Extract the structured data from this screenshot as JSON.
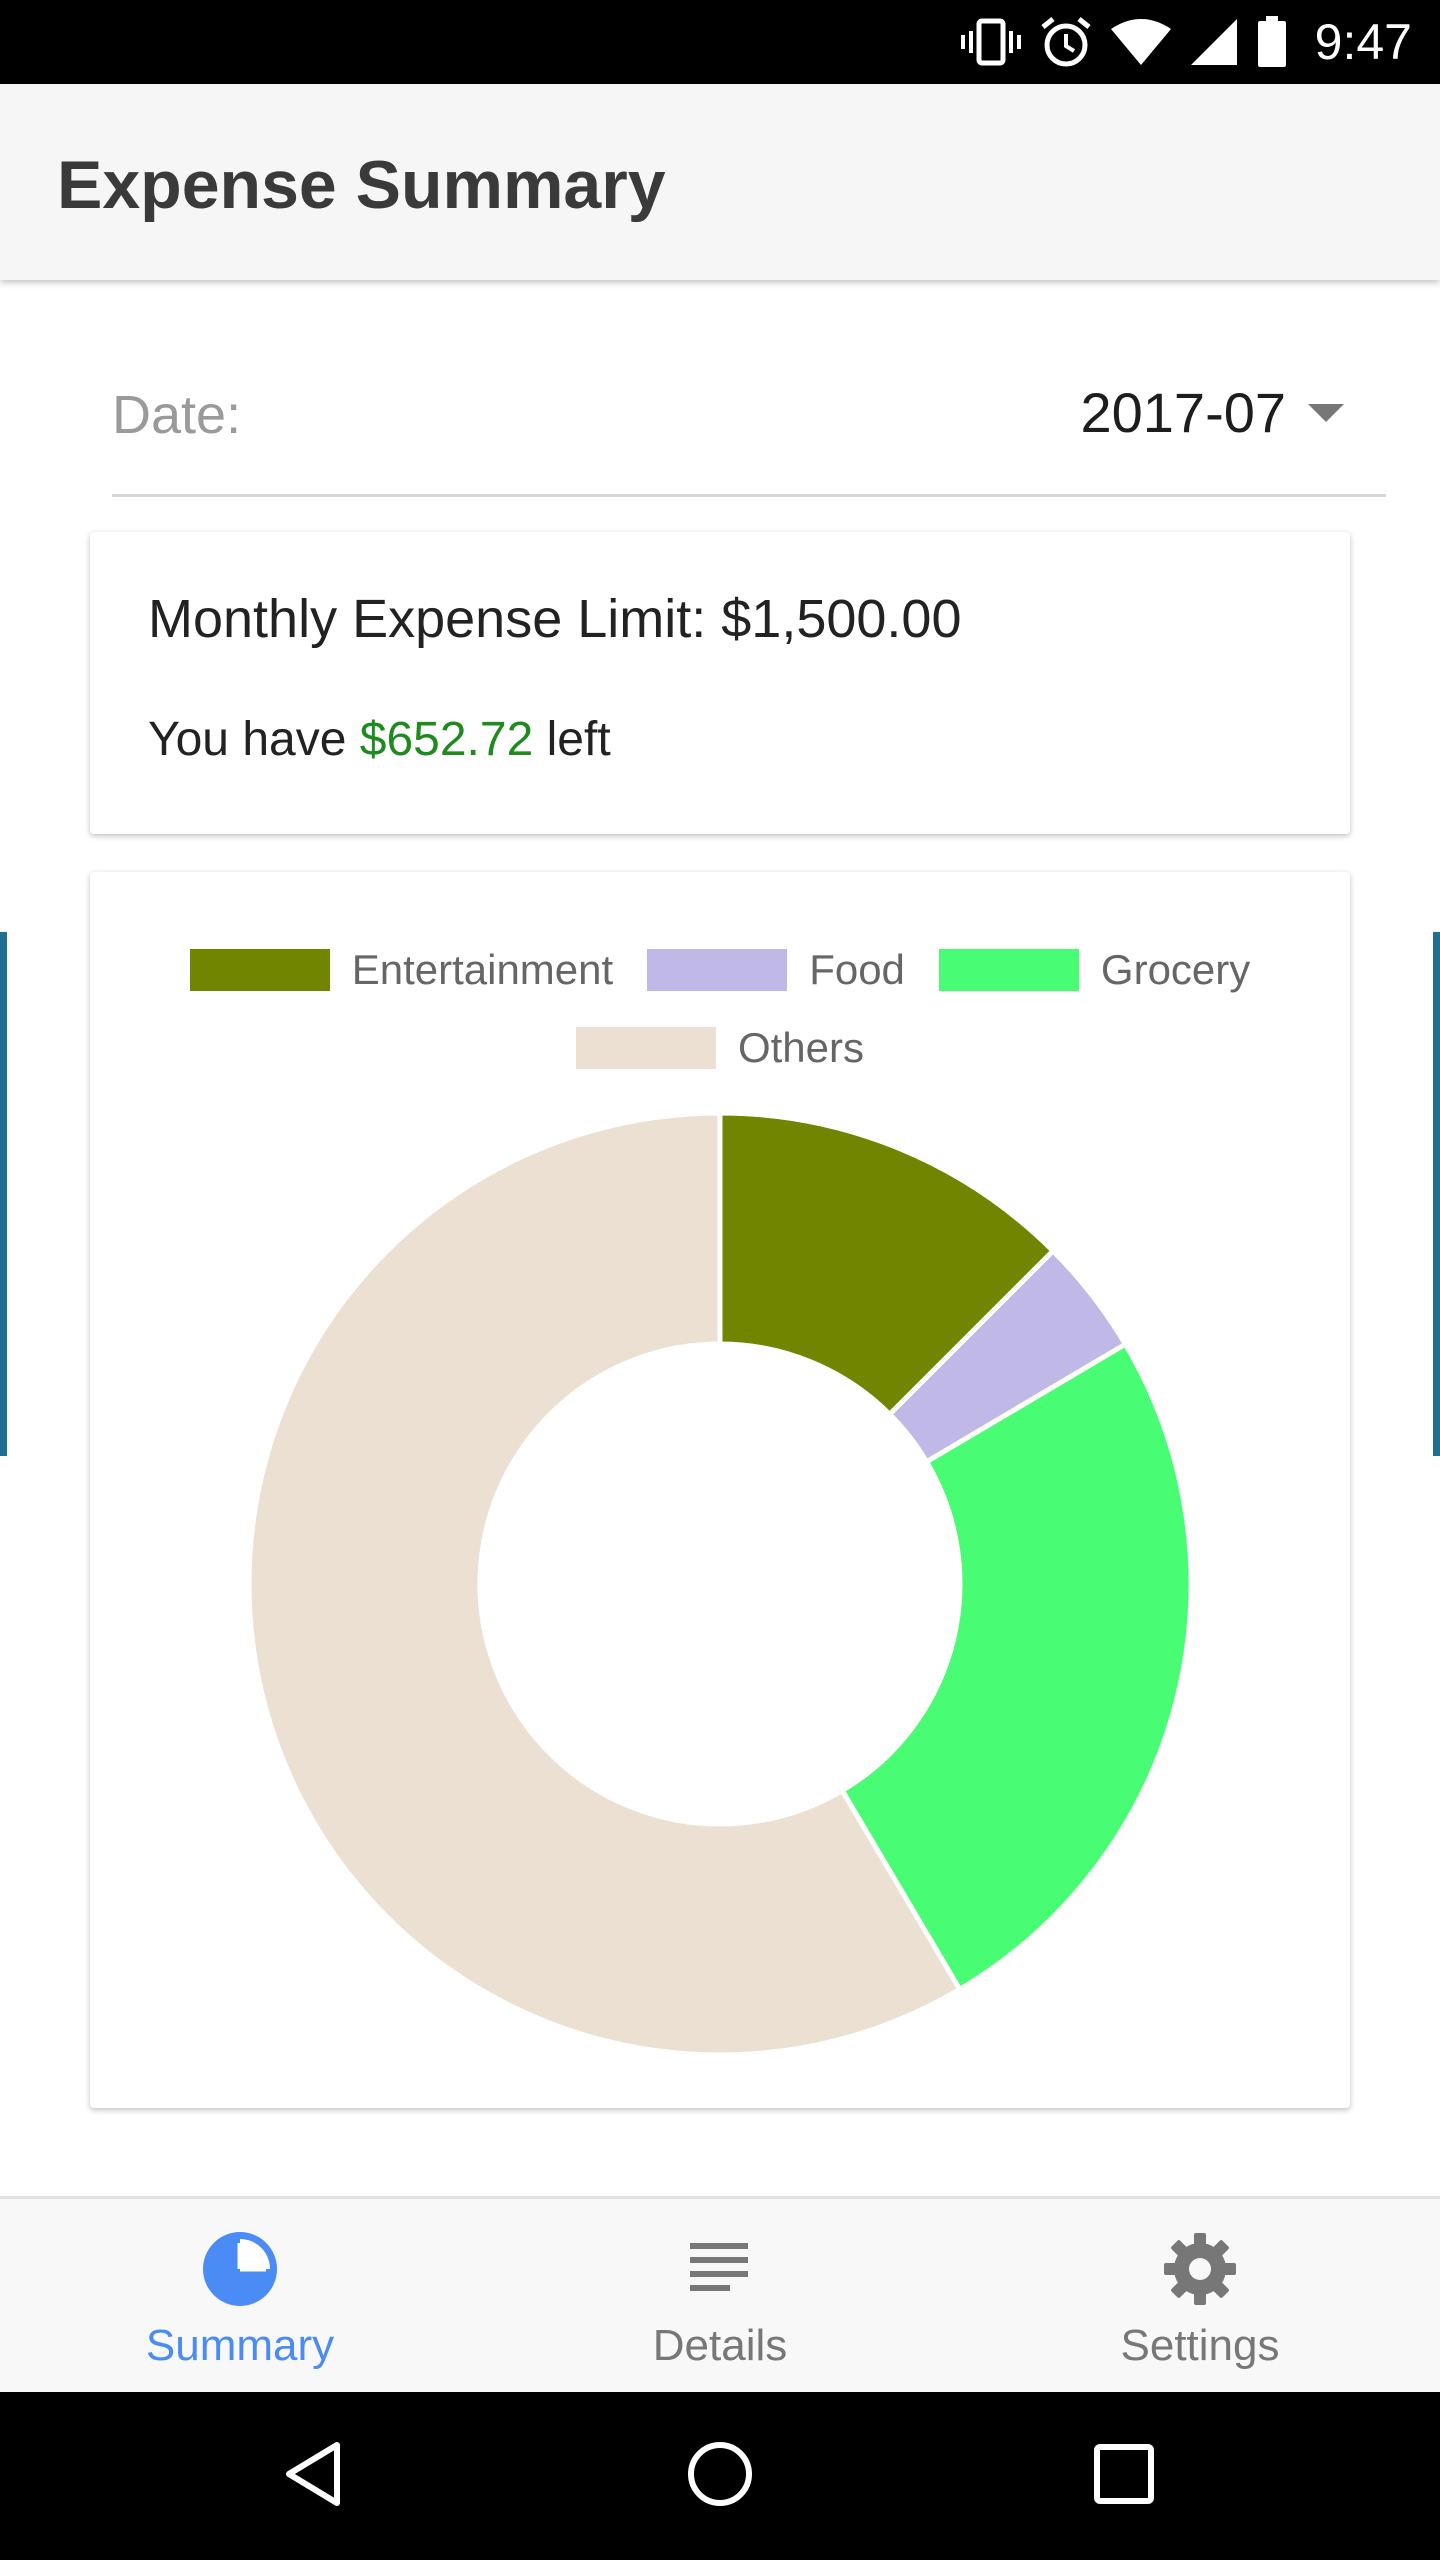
{
  "status_bar": {
    "time": "9:47",
    "icons": [
      "vibrate-icon",
      "alarm-icon",
      "wifi-icon",
      "signal-icon",
      "battery-icon"
    ]
  },
  "app_bar": {
    "title": "Expense Summary"
  },
  "filter": {
    "label": "Date:",
    "value": "2017-07"
  },
  "limit_card": {
    "title": "Monthly Expense Limit: $1,500.00",
    "prefix": "You have ",
    "amount": "$652.72",
    "suffix": " left",
    "amount_color": "#1f8a1f"
  },
  "chart_data": {
    "type": "pie",
    "donut": true,
    "legend_position": "top",
    "categories": [
      "Entertainment",
      "Food",
      "Grocery",
      "Others"
    ],
    "values": [
      12.5,
      4,
      25,
      58.5
    ],
    "colors": [
      "#718500",
      "#c0b9e8",
      "#48fc73",
      "#ece0d3"
    ]
  },
  "bottom_nav": {
    "items": [
      {
        "label": "Summary",
        "icon": "pie-chart-icon",
        "active": true
      },
      {
        "label": "Details",
        "icon": "list-icon",
        "active": false
      },
      {
        "label": "Settings",
        "icon": "gear-icon",
        "active": false
      }
    ],
    "active_color": "#4a8bf5",
    "inactive_color": "#777777"
  },
  "system_nav": {
    "icons": [
      "back-icon",
      "home-icon",
      "recents-icon"
    ]
  }
}
